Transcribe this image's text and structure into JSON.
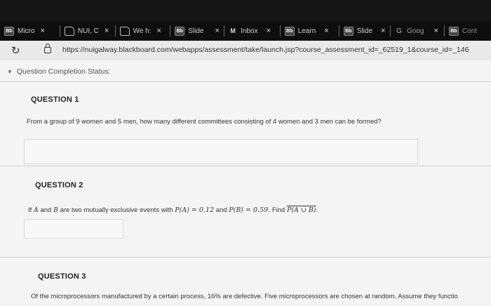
{
  "browser": {
    "tabs": [
      {
        "favicon": "bb",
        "favicon_text": "Bb",
        "label": "Micro"
      },
      {
        "favicon": "blank",
        "favicon_text": "",
        "label": "NUI, C"
      },
      {
        "favicon": "blank",
        "favicon_text": "",
        "label": "We h:"
      },
      {
        "favicon": "bb",
        "favicon_text": "Bb",
        "label": "Slide"
      },
      {
        "favicon": "gmail",
        "favicon_text": "M",
        "label": "Inbox"
      },
      {
        "favicon": "bb",
        "favicon_text": "Bb",
        "label": "Learn"
      },
      {
        "favicon": "bb",
        "favicon_text": "Bb",
        "label": "Slide"
      },
      {
        "favicon": "g",
        "favicon_text": "G",
        "label": "Goog"
      },
      {
        "favicon": "bb",
        "favicon_text": "Bb",
        "label": "Cont"
      }
    ],
    "close_glyph": "×",
    "url": "https://nuigalway.blackboard.com/webapps/assessment/take/launch.jsp?course_assessment_id=_62519_1&course_id=_146"
  },
  "page": {
    "status_label": "Question Completion Status:",
    "questions": [
      {
        "title": "QUESTION 1",
        "text": "From a group of 9 women and 5 men, how many different committees consisting of 4 women and 3 men can be formed?"
      },
      {
        "title": "QUESTION 2",
        "text_parts": {
          "if": "If",
          "a": "A",
          "and1": "and",
          "b": "B",
          "mid": "are two mutually exclusive events with",
          "pa": "P(A) = 0.12",
          "and2": "and",
          "pb": "P(B) = 0.59.",
          "find": "Find",
          "target": "P(A ∪ B)",
          "end": "."
        }
      },
      {
        "title": "QUESTION 3",
        "text": "Of the microprocessors manufactured by a certain process, 16% are defective. Five microprocessors are chosen at random. Assume they functio"
      }
    ]
  }
}
